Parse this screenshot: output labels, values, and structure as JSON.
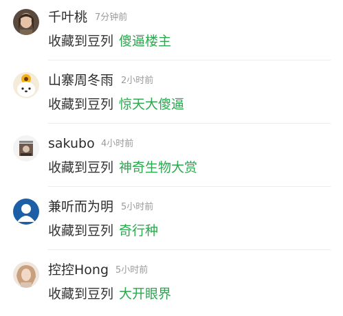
{
  "feed": {
    "items": [
      {
        "user": "千叶桃",
        "time": "7分钟前",
        "action": "收藏到豆列",
        "doulist": "傻逼楼主",
        "avatar": "photo-avatar"
      },
      {
        "user": "山寨周冬雨",
        "time": "2小时前",
        "action": "收藏到豆列",
        "doulist": "惊天大傻逼",
        "avatar": "dog-sunflower-avatar"
      },
      {
        "user": "sakubo",
        "time": "4小时前",
        "action": "收藏到豆列",
        "doulist": "神奇生物大赏",
        "avatar": "photo-avatar"
      },
      {
        "user": "兼听而为明",
        "time": "5小时前",
        "action": "收藏到豆列",
        "doulist": "奇行种",
        "avatar": "default-user-avatar"
      },
      {
        "user": "控控Hong",
        "time": "5小时前",
        "action": "收藏到豆列",
        "doulist": "大开眼界",
        "avatar": "photo-avatar"
      }
    ]
  },
  "colors": {
    "link_green": "#2aa84d",
    "default_avatar_blue": "#1d5fa6",
    "time_gray": "#9a9a9a"
  }
}
